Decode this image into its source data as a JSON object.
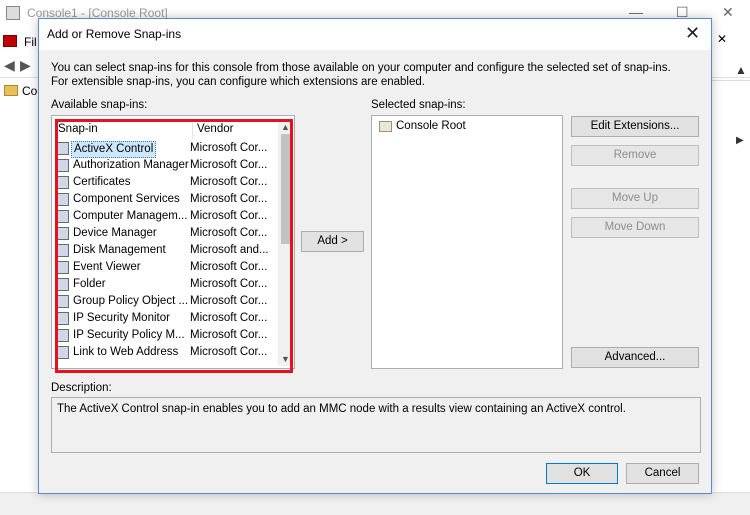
{
  "background_window": {
    "title": "Console1 - [Console Root]",
    "menu_file": "Fil",
    "tree_item": "Co",
    "close_glyph": "✕",
    "minimize_glyph": "—",
    "maximize_glyph": "☐"
  },
  "dialog": {
    "title": "Add or Remove Snap-ins",
    "intro": "You can select snap-ins for this console from those available on your computer and configure the selected set of snap-ins. For extensible snap-ins, you can configure which extensions are enabled.",
    "available_label": "Available snap-ins:",
    "selected_label": "Selected snap-ins:",
    "columns": {
      "snapin": "Snap-in",
      "vendor": "Vendor"
    },
    "snapins": [
      {
        "name": "ActiveX Control",
        "vendor": "Microsoft Cor...",
        "icon": "activex-icon",
        "selected": true
      },
      {
        "name": "Authorization Manager",
        "vendor": "Microsoft Cor...",
        "icon": "authorization-icon"
      },
      {
        "name": "Certificates",
        "vendor": "Microsoft Cor...",
        "icon": "certificate-icon"
      },
      {
        "name": "Component Services",
        "vendor": "Microsoft Cor...",
        "icon": "component-services-icon"
      },
      {
        "name": "Computer Managem...",
        "vendor": "Microsoft Cor...",
        "icon": "computer-management-icon"
      },
      {
        "name": "Device Manager",
        "vendor": "Microsoft Cor...",
        "icon": "device-manager-icon"
      },
      {
        "name": "Disk Management",
        "vendor": "Microsoft and...",
        "icon": "disk-icon"
      },
      {
        "name": "Event Viewer",
        "vendor": "Microsoft Cor...",
        "icon": "event-viewer-icon"
      },
      {
        "name": "Folder",
        "vendor": "Microsoft Cor...",
        "icon": "folder-icon"
      },
      {
        "name": "Group Policy Object ...",
        "vendor": "Microsoft Cor...",
        "icon": "group-policy-icon"
      },
      {
        "name": "IP Security Monitor",
        "vendor": "Microsoft Cor...",
        "icon": "ip-security-icon"
      },
      {
        "name": "IP Security Policy M...",
        "vendor": "Microsoft Cor...",
        "icon": "ip-security-policy-icon"
      },
      {
        "name": "Link to Web Address",
        "vendor": "Microsoft Cor...",
        "icon": "web-link-icon"
      }
    ],
    "add_button": "Add >",
    "selected_items": [
      "Console Root"
    ],
    "buttons": {
      "edit_extensions": "Edit Extensions...",
      "remove": "Remove",
      "move_up": "Move Up",
      "move_down": "Move Down",
      "advanced": "Advanced..."
    },
    "description_label": "Description:",
    "description": "The ActiveX Control snap-in enables you to add an MMC node with a results view containing an ActiveX control.",
    "ok": "OK",
    "cancel": "Cancel",
    "close_glyph": "✕"
  },
  "colors": {
    "highlight_border": "#e8101e",
    "selection_bg": "#cce8ff",
    "dialog_bg": "#f0f0f0",
    "accent": "#0078d7"
  }
}
